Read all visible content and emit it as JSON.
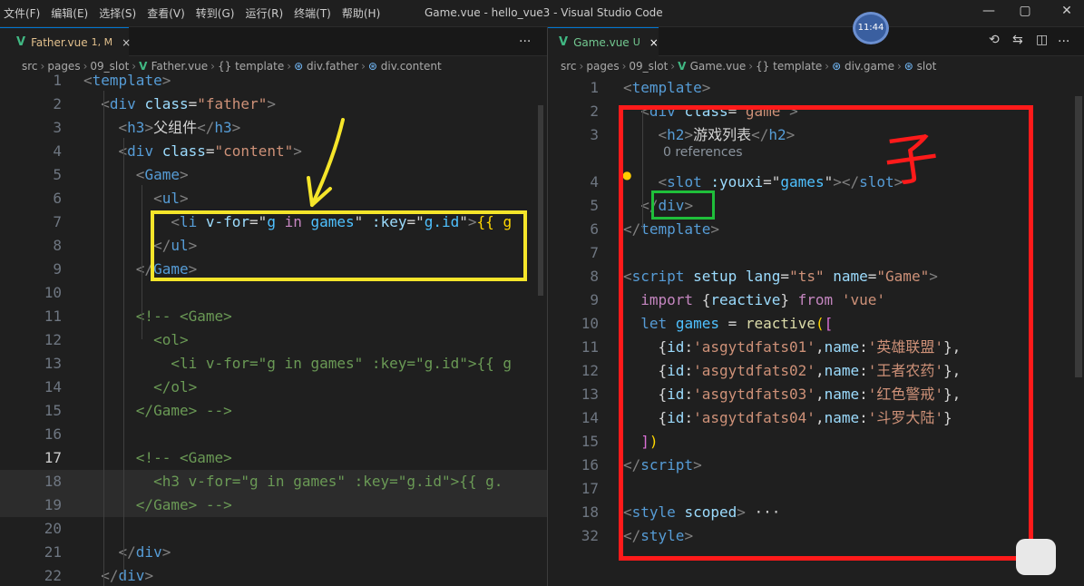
{
  "menu": [
    "文件(F)",
    "编辑(E)",
    "选择(S)",
    "查看(V)",
    "转到(G)",
    "运行(R)",
    "终端(T)",
    "帮助(H)"
  ],
  "window_title": "Game.vue - hello_vue3 - Visual Studio Code",
  "clock": "11:44",
  "win_controls": {
    "min": "—",
    "max": "▢",
    "close": "✕"
  },
  "icons": {
    "vue": "V",
    "close": "×",
    "more": "···",
    "history": "⟲",
    "compare": "⇆",
    "split": "◫",
    "bulb": "●"
  },
  "left": {
    "tab": {
      "name": "Father.vue",
      "status": "1, M"
    },
    "breadcrumb": [
      "src",
      "pages",
      "09_slot",
      "Father.vue",
      "{} template",
      "div.father",
      "div.content"
    ]
  },
  "right": {
    "tab": {
      "name": "Game.vue",
      "status": "U"
    },
    "breadcrumb": [
      "src",
      "pages",
      "09_slot",
      "Game.vue",
      "{} template",
      "div.game",
      "slot"
    ],
    "code_lens": "0 references"
  },
  "annotation": "子",
  "left_code": [
    {
      "n": "1",
      "t": [
        [
          "<",
          "pu"
        ],
        [
          "template",
          "tg"
        ],
        [
          ">",
          "pu"
        ]
      ]
    },
    {
      "n": "2",
      "t": [
        [
          "  <",
          "pu"
        ],
        [
          "div",
          "tg"
        ],
        [
          " ",
          "tx"
        ],
        [
          "class",
          "at"
        ],
        [
          "=",
          "tx"
        ],
        [
          "\"father\"",
          "st"
        ],
        [
          ">",
          "pu"
        ]
      ]
    },
    {
      "n": "3",
      "t": [
        [
          "    <",
          "pu"
        ],
        [
          "h3",
          "tg"
        ],
        [
          ">",
          "pu"
        ],
        [
          "父组件",
          "tx"
        ],
        [
          "</",
          "pu"
        ],
        [
          "h3",
          "tg"
        ],
        [
          ">",
          "pu"
        ]
      ]
    },
    {
      "n": "4",
      "t": [
        [
          "    <",
          "pu"
        ],
        [
          "div",
          "tg"
        ],
        [
          " ",
          "tx"
        ],
        [
          "class",
          "at"
        ],
        [
          "=",
          "tx"
        ],
        [
          "\"content\"",
          "st"
        ],
        [
          ">",
          "pu"
        ]
      ]
    },
    {
      "n": "5",
      "t": [
        [
          "      <",
          "pu"
        ],
        [
          "Game",
          "tg"
        ],
        [
          ">",
          "pu"
        ]
      ]
    },
    {
      "n": "6",
      "t": [
        [
          "        <",
          "pu"
        ],
        [
          "ul",
          "tg"
        ],
        [
          ">",
          "pu"
        ]
      ]
    },
    {
      "n": "7",
      "t": [
        [
          "          <",
          "pu"
        ],
        [
          "li",
          "tg"
        ],
        [
          " ",
          "tx"
        ],
        [
          "v-for",
          "at"
        ],
        [
          "=\"",
          "tx"
        ],
        [
          "g",
          "vr"
        ],
        [
          " in ",
          "kw"
        ],
        [
          "games",
          "vr"
        ],
        [
          "\"",
          "tx"
        ],
        [
          " :key",
          "at"
        ],
        [
          "=\"",
          "tx"
        ],
        [
          "g.id",
          "vr"
        ],
        [
          "\"",
          "tx"
        ],
        [
          ">",
          "pu"
        ],
        [
          "{{ g",
          "br1"
        ]
      ]
    },
    {
      "n": "8",
      "t": [
        [
          "        </",
          "pu"
        ],
        [
          "ul",
          "tg"
        ],
        [
          ">",
          "pu"
        ]
      ]
    },
    {
      "n": "9",
      "t": [
        [
          "      </",
          "pu"
        ],
        [
          "Game",
          "tg"
        ],
        [
          ">",
          "pu"
        ]
      ]
    },
    {
      "n": "10",
      "t": [
        [
          "",
          "tx"
        ]
      ]
    },
    {
      "n": "11",
      "t": [
        [
          "      <!-- <Game>",
          "cm"
        ]
      ]
    },
    {
      "n": "12",
      "t": [
        [
          "        <ol>",
          "cm"
        ]
      ]
    },
    {
      "n": "13",
      "t": [
        [
          "          <li v-for=\"g in games\" :key=\"g.id\">{{ g",
          "cm"
        ]
      ]
    },
    {
      "n": "14",
      "t": [
        [
          "        </ol>",
          "cm"
        ]
      ]
    },
    {
      "n": "15",
      "t": [
        [
          "      </Game> -->",
          "cm"
        ]
      ]
    },
    {
      "n": "16",
      "t": [
        [
          "",
          "tx"
        ]
      ]
    },
    {
      "n": "17",
      "t": [
        [
          "      <!-- ",
          "cm"
        ],
        [
          "<Game>",
          "cm"
        ]
      ]
    },
    {
      "n": "18",
      "t": [
        [
          "        <h3 v-for=\"g in games\" :key=\"g.id\">{{ g.",
          "cm"
        ]
      ]
    },
    {
      "n": "19",
      "t": [
        [
          "      </Game> -->",
          "cm"
        ]
      ]
    },
    {
      "n": "20",
      "t": [
        [
          "",
          "tx"
        ]
      ]
    },
    {
      "n": "21",
      "t": [
        [
          "    </",
          "pu"
        ],
        [
          "div",
          "tg"
        ],
        [
          ">",
          "pu"
        ]
      ]
    },
    {
      "n": "22",
      "t": [
        [
          "  </",
          "pu"
        ],
        [
          "div",
          "tg"
        ],
        [
          ">",
          "pu"
        ]
      ]
    }
  ],
  "right_code": [
    {
      "n": "1",
      "t": [
        [
          "<",
          "pu"
        ],
        [
          "template",
          "tg"
        ],
        [
          ">",
          "pu"
        ]
      ]
    },
    {
      "n": "2",
      "t": [
        [
          "  <",
          "pu"
        ],
        [
          "div",
          "tg"
        ],
        [
          " ",
          "tx"
        ],
        [
          "class",
          "at"
        ],
        [
          "=",
          "tx"
        ],
        [
          "\"game\"",
          "st"
        ],
        [
          ">",
          "pu"
        ]
      ]
    },
    {
      "n": "3",
      "t": [
        [
          "    <",
          "pu"
        ],
        [
          "h2",
          "tg"
        ],
        [
          ">",
          "pu"
        ],
        [
          "游戏列表",
          "tx"
        ],
        [
          "</",
          "pu"
        ],
        [
          "h2",
          "tg"
        ],
        [
          ">",
          "pu"
        ]
      ]
    },
    {
      "n": "4",
      "t": [
        [
          "    <",
          "pu"
        ],
        [
          "slot",
          "tg"
        ],
        [
          " ",
          "tx"
        ],
        [
          ":youxi",
          "at"
        ],
        [
          "=\"",
          "tx"
        ],
        [
          "games",
          "vr"
        ],
        [
          "\"",
          "tx"
        ],
        [
          "></",
          "pu"
        ],
        [
          "slot",
          "tg"
        ],
        [
          ">",
          "pu"
        ]
      ]
    },
    {
      "n": "5",
      "t": [
        [
          "  </",
          "pu"
        ],
        [
          "div",
          "tg"
        ],
        [
          ">",
          "pu"
        ]
      ]
    },
    {
      "n": "6",
      "t": [
        [
          "</",
          "pu"
        ],
        [
          "template",
          "tg"
        ],
        [
          ">",
          "pu"
        ]
      ]
    },
    {
      "n": "7",
      "t": [
        [
          "",
          "tx"
        ]
      ]
    },
    {
      "n": "8",
      "t": [
        [
          "<",
          "pu"
        ],
        [
          "script",
          "tg"
        ],
        [
          " ",
          "tx"
        ],
        [
          "setup",
          "at"
        ],
        [
          " ",
          "tx"
        ],
        [
          "lang",
          "at"
        ],
        [
          "=",
          "tx"
        ],
        [
          "\"ts\"",
          "st"
        ],
        [
          " ",
          "tx"
        ],
        [
          "name",
          "at"
        ],
        [
          "=",
          "tx"
        ],
        [
          "\"Game\"",
          "st"
        ],
        [
          ">",
          "pu"
        ]
      ]
    },
    {
      "n": "9",
      "t": [
        [
          "  ",
          "tx"
        ],
        [
          "import",
          "kw"
        ],
        [
          " {",
          "pl"
        ],
        [
          "reactive",
          "at"
        ],
        [
          "} ",
          "pl"
        ],
        [
          "from",
          "kw"
        ],
        [
          " ",
          "tx"
        ],
        [
          "'vue'",
          "st"
        ]
      ]
    },
    {
      "n": "10",
      "t": [
        [
          "  ",
          "tx"
        ],
        [
          "let",
          "kd"
        ],
        [
          " ",
          "tx"
        ],
        [
          "games",
          "vr"
        ],
        [
          " = ",
          "pl"
        ],
        [
          "reactive",
          "fn"
        ],
        [
          "(",
          "br1"
        ],
        [
          "[",
          "br2"
        ]
      ]
    },
    {
      "n": "11",
      "t": [
        [
          "    {",
          "pl"
        ],
        [
          "id",
          "at"
        ],
        [
          ":",
          "pl"
        ],
        [
          "'asgytdfats01'",
          "st"
        ],
        [
          ",",
          "pl"
        ],
        [
          "name",
          "at"
        ],
        [
          ":",
          "pl"
        ],
        [
          "'英雄联盟'",
          "st"
        ],
        [
          "},",
          "pl"
        ]
      ]
    },
    {
      "n": "12",
      "t": [
        [
          "    {",
          "pl"
        ],
        [
          "id",
          "at"
        ],
        [
          ":",
          "pl"
        ],
        [
          "'asgytdfats02'",
          "st"
        ],
        [
          ",",
          "pl"
        ],
        [
          "name",
          "at"
        ],
        [
          ":",
          "pl"
        ],
        [
          "'王者农药'",
          "st"
        ],
        [
          "},",
          "pl"
        ]
      ]
    },
    {
      "n": "13",
      "t": [
        [
          "    {",
          "pl"
        ],
        [
          "id",
          "at"
        ],
        [
          ":",
          "pl"
        ],
        [
          "'asgytdfats03'",
          "st"
        ],
        [
          ",",
          "pl"
        ],
        [
          "name",
          "at"
        ],
        [
          ":",
          "pl"
        ],
        [
          "'红色警戒'",
          "st"
        ],
        [
          "},",
          "pl"
        ]
      ]
    },
    {
      "n": "14",
      "t": [
        [
          "    {",
          "pl"
        ],
        [
          "id",
          "at"
        ],
        [
          ":",
          "pl"
        ],
        [
          "'asgytdfats04'",
          "st"
        ],
        [
          ",",
          "pl"
        ],
        [
          "name",
          "at"
        ],
        [
          ":",
          "pl"
        ],
        [
          "'斗罗大陆'",
          "st"
        ],
        [
          "}",
          "pl"
        ]
      ]
    },
    {
      "n": "15",
      "t": [
        [
          "  ",
          "tx"
        ],
        [
          "]",
          "br2"
        ],
        [
          ")",
          "br1"
        ]
      ]
    },
    {
      "n": "16",
      "t": [
        [
          "</",
          "pu"
        ],
        [
          "script",
          "tg"
        ],
        [
          ">",
          "pu"
        ]
      ]
    },
    {
      "n": "17",
      "t": [
        [
          "",
          "tx"
        ]
      ]
    },
    {
      "n": "18",
      "t": [
        [
          "<",
          "pu"
        ],
        [
          "style",
          "tg"
        ],
        [
          " ",
          "tx"
        ],
        [
          "scoped",
          "at"
        ],
        [
          ">",
          "pu"
        ],
        [
          " ···",
          "tx"
        ]
      ]
    },
    {
      "n": "32",
      "t": [
        [
          "</",
          "pu"
        ],
        [
          "style",
          "tg"
        ],
        [
          ">",
          "pu"
        ]
      ]
    }
  ]
}
